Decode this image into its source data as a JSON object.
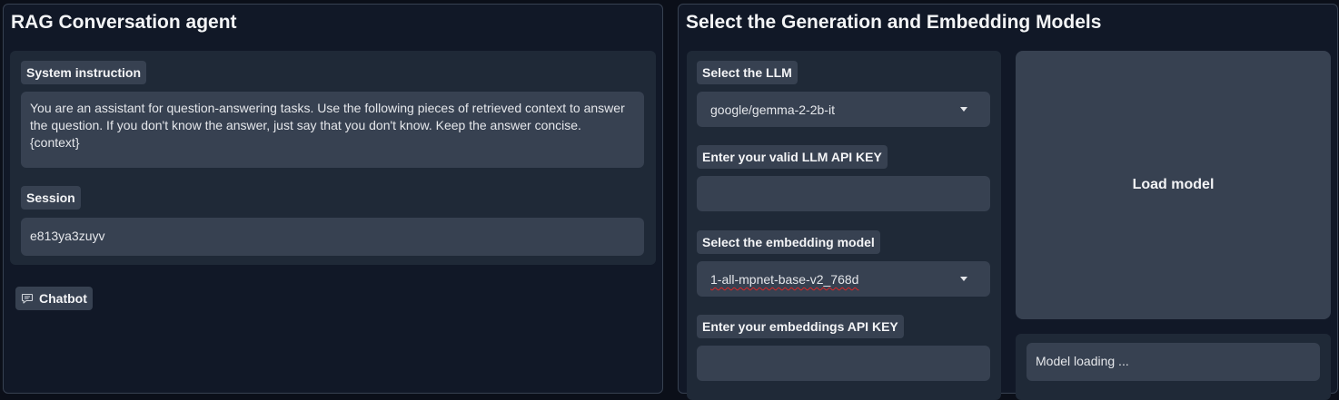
{
  "left_panel": {
    "title": "RAG Conversation agent",
    "system_instruction": {
      "label": "System instruction",
      "value": "You are an assistant for question-answering tasks. Use the following pieces of retrieved context to answer the question. If you don't know the answer, just say that you don't know. Keep the answer concise. {context}"
    },
    "session": {
      "label": "Session",
      "value": "e813ya3zuyv"
    },
    "chatbot": {
      "label": "Chatbot",
      "icon": "chat-icon"
    }
  },
  "right_panel": {
    "title": "Select the Generation and Embedding Models",
    "llm_select": {
      "label": "Select the LLM",
      "value": "google/gemma-2-2b-it"
    },
    "llm_api_key": {
      "label": "Enter your valid LLM API KEY",
      "value": ""
    },
    "embedding_select": {
      "label": "Select the embedding model",
      "value": "1-all-mpnet-base-v2_768d"
    },
    "embedding_api_key": {
      "label": "Enter your embeddings API KEY",
      "value": ""
    },
    "load_button": {
      "label": "Load model"
    },
    "status": {
      "value": "Model loading ..."
    }
  }
}
